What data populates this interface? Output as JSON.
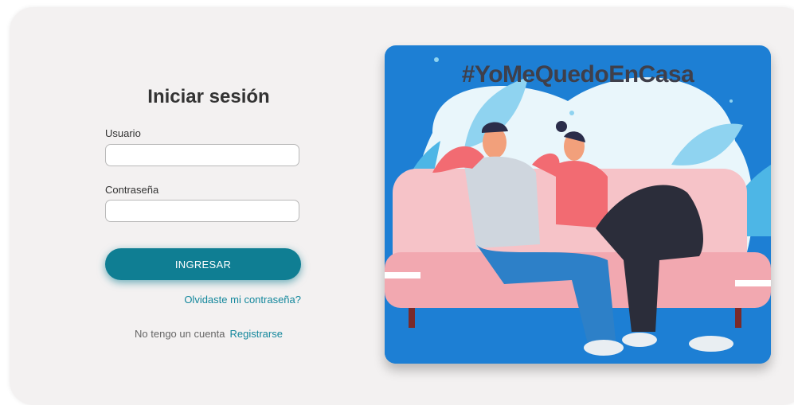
{
  "login": {
    "title": "Iniciar sesión",
    "username_label": "Usuario",
    "username_value": "",
    "password_label": "Contraseña",
    "password_value": "",
    "submit_label": "INGRESAR",
    "forgot_label": "Olvidaste mi contraseña?",
    "no_account_text": "No tengo un cuenta",
    "register_label": "Registrarse"
  },
  "hero": {
    "hashtag": "#YoMeQuedoEnCasa"
  },
  "colors": {
    "card_bg": "#f3f1f1",
    "accent": "#0f7e93",
    "link": "#13879c",
    "hero_bg": "#1d7fd4"
  }
}
